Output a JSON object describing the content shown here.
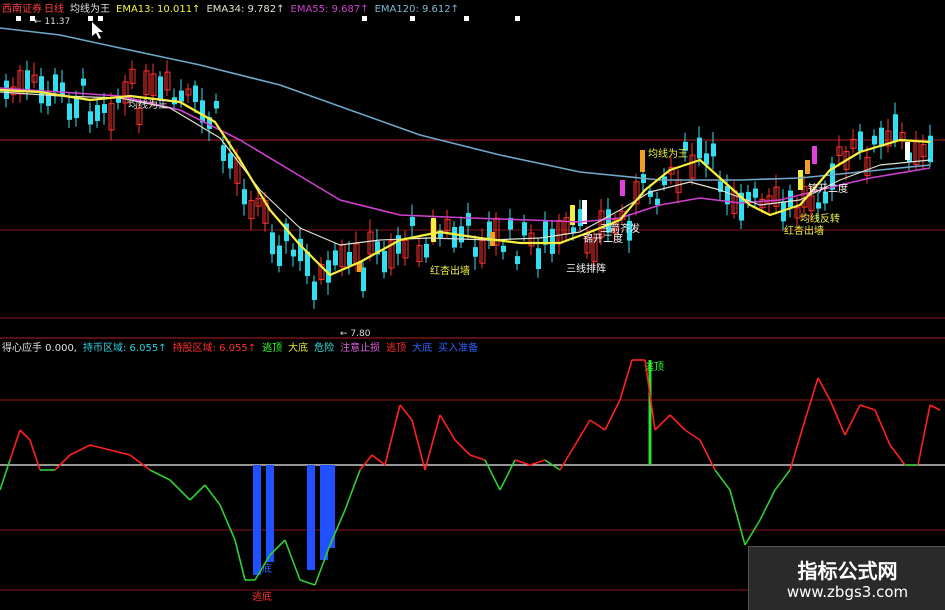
{
  "header": {
    "source": "西南证券",
    "period": "日线",
    "indicator_name": "均线为王",
    "ema13": "EMA13: 10.011↑",
    "ema34": "EMA34: 9.782↑",
    "ema55": "EMA55: 9.687↑",
    "ema120": "EMA120: 9.612↑"
  },
  "sub_header": {
    "name": "得心应手 0.000,",
    "items": [
      {
        "text": "持币区域: 6.055↑",
        "color": "#30d0e0"
      },
      {
        "text": "持股区域: 6.055↑",
        "color": "#ff3030"
      },
      {
        "text": "逃顶",
        "color": "#30ff30"
      },
      {
        "text": "大底",
        "color": "#e0e030"
      },
      {
        "text": "危险",
        "color": "#30e0e0"
      },
      {
        "text": "注意止损",
        "color": "#e060e0"
      },
      {
        "text": "逃顶",
        "color": "#ff3030"
      },
      {
        "text": "大底",
        "color": "#3060ff"
      },
      {
        "text": "买入准备",
        "color": "#3060ff"
      }
    ]
  },
  "labels": {
    "high_price": "11.37",
    "low_price": "7.80",
    "ma_signal_1": "均线为王",
    "daily_signal": "红杏出墙",
    "signal_3line": "三线排阵",
    "signal_ssk": "锦开二度",
    "signal_jiaoji": "三箭齐发",
    "signal_jiao2": "锦开二度",
    "signal_gjzh": "红杏出墙",
    "signal_qs": "均线反转",
    "top_sig": "逃顶",
    "bottom_sig": "底",
    "bottom_sig2": "逃底"
  },
  "watermark": {
    "title": "指标公式网",
    "url": "www.zbgs3.com"
  },
  "colors": {
    "up": "#ff3030",
    "down": "#30e0f0",
    "ema13": "#f8f040",
    "ema34": "#e0e0d0",
    "ema55": "#d040d0",
    "ema120": "#70a8c8",
    "osc_up": "#ff2020",
    "osc_down": "#30d030",
    "zero": "#f0f0f0",
    "blue_bar": "#2050ff"
  }
}
